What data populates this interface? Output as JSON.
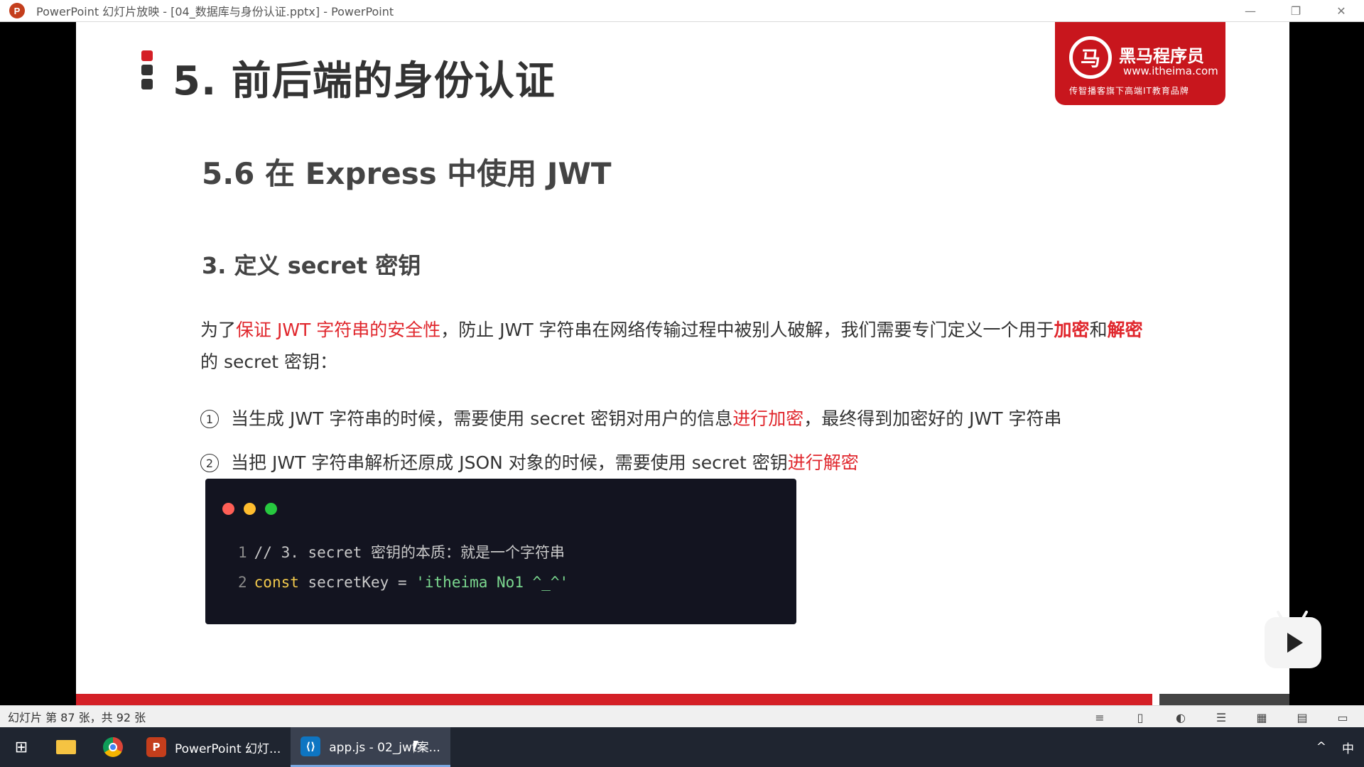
{
  "window": {
    "app_icon": "powerpoint-icon",
    "app_icon_letter": "P",
    "title": "PowerPoint 幻灯片放映 - [04_数据库与身份认证.pptx] - PowerPoint",
    "minimize": "—",
    "restore": "❐",
    "close": "✕"
  },
  "slide": {
    "title": "5. 前后端的身份认证",
    "logo": {
      "mark": "马",
      "name": "黑马程序员",
      "url": "www.itheima.com",
      "slogan": "传智播客旗下高端IT教育品牌"
    },
    "subtitle": "5.6 在 Express 中使用 JWT",
    "point_title": "3. 定义 secret 密钥",
    "paragraph": {
      "p1": "为了",
      "p2": "保证 JWT 字符串的安全性",
      "p3": "，防止 JWT 字符串在网络传输过程中被别人破解，我们需要专门定义一个用于",
      "p4": "加密",
      "p5": "和",
      "p6": "解密",
      "p7": "的 secret 密钥："
    },
    "items": [
      {
        "num": "1",
        "text_a": "当生成 JWT 字符串的时候，需要使用 secret 密钥对用户的信息",
        "text_red": "进行加密",
        "text_b": "，最终得到加密好的 JWT 字符串"
      },
      {
        "num": "2",
        "text_a": "当把 JWT 字符串解析还原成 JSON 对象的时候，需要使用 secret 密钥",
        "text_red": "进行解密",
        "text_b": ""
      }
    ],
    "code": {
      "dot_colors": [
        "#ff5f56",
        "#ffbd2e",
        "#27c93f"
      ],
      "lines": [
        {
          "n": "1",
          "comment": "// 3. secret 密钥的本质：就是一个字符串"
        },
        {
          "n": "2",
          "keyword": "const",
          "plain": " secretKey = ",
          "string": "'itheima No1 ^_^'"
        }
      ]
    },
    "accent_color": "#d41f26"
  },
  "statusbar": {
    "slide_info": "幻灯片 第 87 张，共 92 张",
    "icons": [
      "notes-icon",
      "comments-icon",
      "normal-view-icon",
      "outline-view-icon",
      "slide-sorter-icon",
      "reading-view-icon",
      "slideshow-icon"
    ]
  },
  "taskbar": {
    "start": "⊞",
    "apps": [
      {
        "label": "PowerPoint 幻灯...",
        "badge": "P",
        "color": "#c43e1c"
      },
      {
        "label": "app.js - 02_jwt案...",
        "badge": "⟨⟩",
        "color": "#0e75c2"
      }
    ],
    "tray_chevron": "^",
    "ime": "中"
  }
}
